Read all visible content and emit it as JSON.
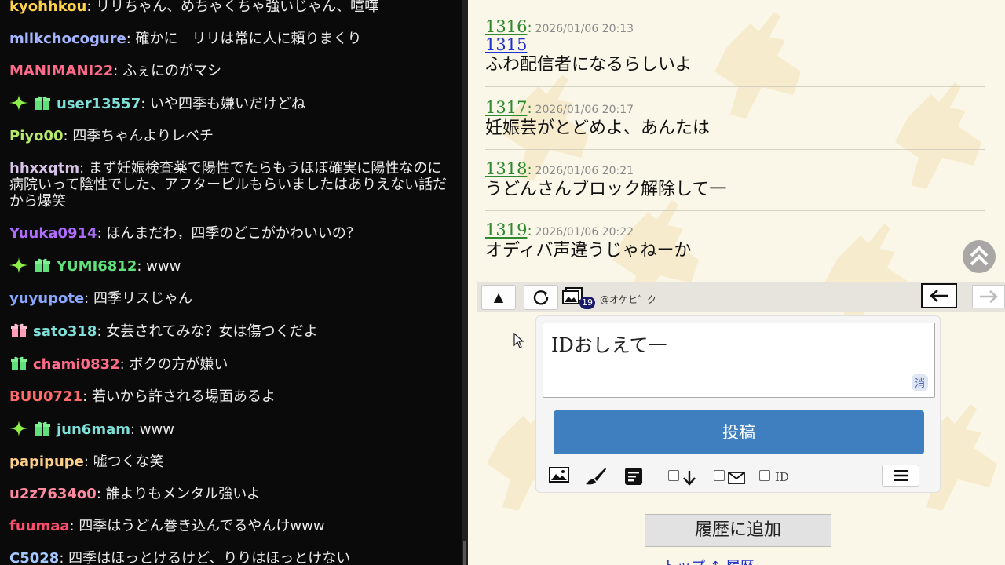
{
  "chat": {
    "messages": [
      {
        "user": "kyohhkou",
        "color": "#ffd24a",
        "badges": [],
        "text": "リリちゃん、めちゃくちゃ強いじゃん、喧嘩"
      },
      {
        "user": "milkchocogure",
        "color": "#a5b4ff",
        "badges": [],
        "text": "確かに　リリは常に人に頼りまくり"
      },
      {
        "user": "MANIMANI22",
        "color": "#ff6b8a",
        "badges": [],
        "text": "ふぇにのがマシ"
      },
      {
        "user": "user13557",
        "color": "#7ee0d8",
        "badges": [
          "sparkle-badge-icon",
          "gift-badge-icon"
        ],
        "text": "いや四季も嫌いだけどね"
      },
      {
        "user": "Piyo00",
        "color": "#b6e86a",
        "badges": [],
        "text": "四季ちゃんよりレベチ"
      },
      {
        "user": "hhxxqtm",
        "color": "#d8c3ea",
        "badges": [],
        "text": "まず妊娠検査薬で陽性でたらもうほぼ確実に陽性なのに病院いって陰性でした、アフターピルもらいましたはありえない話だから爆笑"
      },
      {
        "user": "Yuuka0914",
        "color": "#b06cff",
        "badges": [],
        "text": "ほんまだわ，四季のどこがかわいいの？"
      },
      {
        "user": "YUMI6812",
        "color": "#5fe07a",
        "badges": [
          "sparkle-badge-icon",
          "gift-badge-icon"
        ],
        "text": "www"
      },
      {
        "user": "yuyupote",
        "color": "#8aa7ff",
        "badges": [],
        "text": "四季リスじゃん"
      },
      {
        "user": "sato318",
        "color": "#7ee0d8",
        "badges": [
          "pink-gift-badge-icon"
        ],
        "text": "女芸されてみな？女は傷つくだよ"
      },
      {
        "user": "chami0832",
        "color": "#ff6b8a",
        "badges": [
          "gift-badge-icon"
        ],
        "text": "ボクの方が嫌い"
      },
      {
        "user": "BUU0721",
        "color": "#ff6b6b",
        "badges": [],
        "text": "若いから許される場面あるよ"
      },
      {
        "user": "jun6mam",
        "color": "#7ee0d8",
        "badges": [
          "sparkle-badge-icon",
          "gift-badge-icon"
        ],
        "text": "www"
      },
      {
        "user": "papipupe",
        "color": "#ffd08a",
        "badges": [],
        "text": "嘘つくな笑"
      },
      {
        "user": "u2z7634o0",
        "color": "#ff8aa0",
        "badges": [],
        "text": "誰よりもメンタル強いよ"
      },
      {
        "user": "fuumaa",
        "color": "#ff4d6d",
        "badges": [],
        "text": "四季はうどん巻き込んでるやんけwww"
      },
      {
        "user": "C5028",
        "color": "#a5c8ff",
        "badges": [],
        "text": "四季はほっとけるけど、りりはほっとけない"
      }
    ]
  },
  "board": {
    "posts": [
      {
        "num": "1316",
        "date": "2026/01/06 20:13",
        "ref": "1315",
        "text": "ふわ配信者になるらしいよ"
      },
      {
        "num": "1317",
        "date": "2026/01/06 20:17",
        "ref": "",
        "text": "妊娠芸がとどめよ、あんたは"
      },
      {
        "num": "1318",
        "date": "2026/01/06 20:21",
        "ref": "",
        "text": "うどんさんブロック解除して一"
      },
      {
        "num": "1319",
        "date": "2026/01/06 20:22",
        "ref": "",
        "text": "オディバ声違うじゃねーか"
      }
    ],
    "toolbar": {
      "up_label": "▲",
      "image_count": "19",
      "board_name": "@オケヒ゛ク"
    },
    "form": {
      "message_value": "IDおしえて一",
      "clear_label": "消",
      "submit_label": "投稿",
      "id_label": "ID"
    },
    "history_label": "履歴に追加",
    "bottom_links": "トップ ↑ 履歴"
  },
  "colors": {
    "submit": "#3f7fbf",
    "post_number": "#2f8a2f",
    "reference_link": "#2233cc"
  }
}
